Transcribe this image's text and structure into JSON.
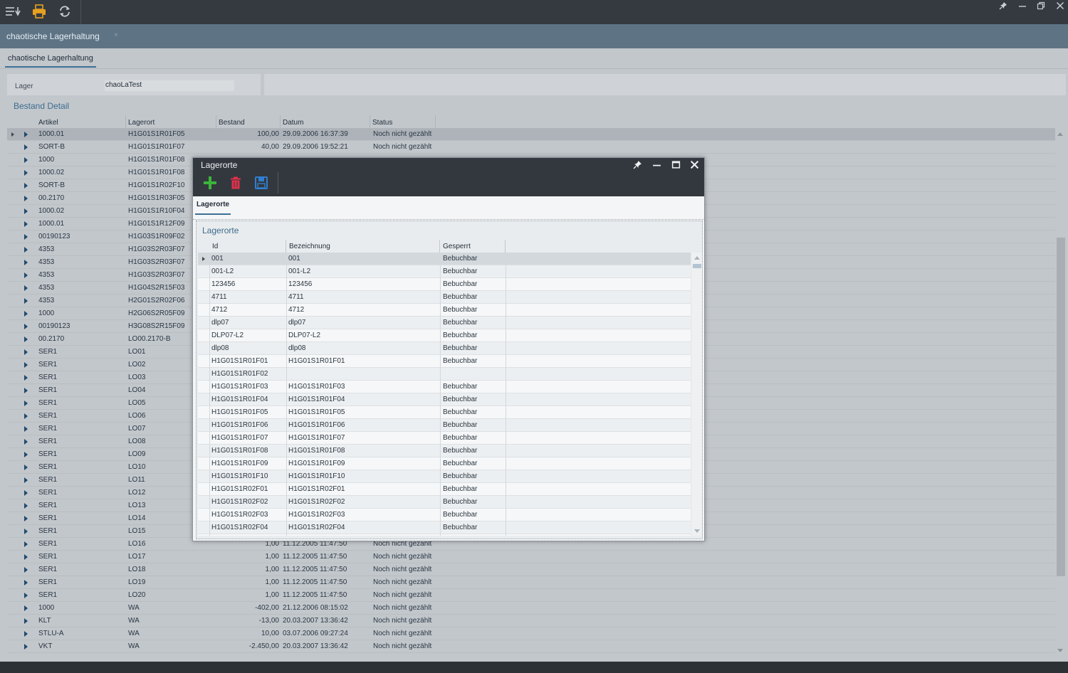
{
  "toolbar": {
    "icons": [
      "grid-export-icon",
      "printer-icon",
      "refresh-icon"
    ],
    "window_controls": [
      "pin-icon",
      "minimize-icon",
      "restore-icon",
      "close-icon"
    ]
  },
  "document_tab": {
    "label": "chaotische Lagerhaltung",
    "close": "×"
  },
  "subtab": {
    "label": "chaotische Lagerhaltung"
  },
  "filter": {
    "label": "Lager",
    "value": "chaoLaTest"
  },
  "section": {
    "title": "Bestand Detail"
  },
  "main_grid": {
    "columns": [
      "Artikel",
      "Lagerort",
      "Bestand",
      "Datum",
      "Status"
    ],
    "rows": [
      [
        "1000.01",
        "H1G01S1R01F05",
        "100,00",
        "29.09.2006 16:37:39",
        "Noch nicht gezählt"
      ],
      [
        "SORT-B",
        "H1G01S1R01F07",
        "40,00",
        "29.09.2006 19:52:21",
        "Noch nicht gezählt"
      ],
      [
        "1000",
        "H1G01S1R01F08",
        "",
        "",
        ""
      ],
      [
        "1000.02",
        "H1G01S1R01F08",
        "",
        "",
        ""
      ],
      [
        "SORT-B",
        "H1G01S1R02F10",
        "",
        "",
        ""
      ],
      [
        "00.2170",
        "H1G01S1R03F05",
        "",
        "",
        ""
      ],
      [
        "1000.02",
        "H1G01S1R10F04",
        "",
        "",
        ""
      ],
      [
        "1000.01",
        "H1G01S1R12F09",
        "",
        "",
        ""
      ],
      [
        "00190123",
        "H1G03S1R09F02",
        "",
        "",
        ""
      ],
      [
        "4353",
        "H1G03S2R03F07",
        "",
        "",
        ""
      ],
      [
        "4353",
        "H1G03S2R03F07",
        "",
        "",
        ""
      ],
      [
        "4353",
        "H1G03S2R03F07",
        "",
        "",
        ""
      ],
      [
        "4353",
        "H1G04S2R15F03",
        "",
        "",
        ""
      ],
      [
        "4353",
        "H2G01S2R02F06",
        "",
        "",
        ""
      ],
      [
        "1000",
        "H2G06S2R05F09",
        "",
        "",
        ""
      ],
      [
        "00190123",
        "H3G08S2R15F09",
        "",
        "",
        ""
      ],
      [
        "00.2170",
        "LO00.2170-B",
        "",
        "",
        ""
      ],
      [
        "SER1",
        "LO01",
        "",
        "",
        ""
      ],
      [
        "SER1",
        "LO02",
        "",
        "",
        ""
      ],
      [
        "SER1",
        "LO03",
        "",
        "",
        ""
      ],
      [
        "SER1",
        "LO04",
        "",
        "",
        ""
      ],
      [
        "SER1",
        "LO05",
        "",
        "",
        ""
      ],
      [
        "SER1",
        "LO06",
        "",
        "",
        ""
      ],
      [
        "SER1",
        "LO07",
        "",
        "",
        ""
      ],
      [
        "SER1",
        "LO08",
        "",
        "",
        ""
      ],
      [
        "SER1",
        "LO09",
        "",
        "",
        ""
      ],
      [
        "SER1",
        "LO10",
        "",
        "",
        ""
      ],
      [
        "SER1",
        "LO11",
        "",
        "",
        ""
      ],
      [
        "SER1",
        "LO12",
        "",
        "",
        ""
      ],
      [
        "SER1",
        "LO13",
        "",
        "",
        ""
      ],
      [
        "SER1",
        "LO14",
        "",
        "",
        ""
      ],
      [
        "SER1",
        "LO15",
        "",
        "",
        ""
      ],
      [
        "SER1",
        "LO16",
        "1,00",
        "11.12.2005 11:47:50",
        "Noch nicht gezählt"
      ],
      [
        "SER1",
        "LO17",
        "1,00",
        "11.12.2005 11:47:50",
        "Noch nicht gezählt"
      ],
      [
        "SER1",
        "LO18",
        "1,00",
        "11.12.2005 11:47:50",
        "Noch nicht gezählt"
      ],
      [
        "SER1",
        "LO19",
        "1,00",
        "11.12.2005 11:47:50",
        "Noch nicht gezählt"
      ],
      [
        "SER1",
        "LO20",
        "1,00",
        "11.12.2005 11:47:50",
        "Noch nicht gezählt"
      ],
      [
        "1000",
        "WA",
        "-402,00",
        "21.12.2006 08:15:02",
        "Noch nicht gezählt"
      ],
      [
        "KLT",
        "WA",
        "-13,00",
        "20.03.2007 13:36:42",
        "Noch nicht gezählt"
      ],
      [
        "STLU-A",
        "WA",
        "10,00",
        "03.07.2006 09:27:24",
        "Noch nicht gezählt"
      ],
      [
        "VKT",
        "WA",
        "-2.450,00",
        "20.03.2007 13:36:42",
        "Noch nicht gezählt"
      ]
    ]
  },
  "modal": {
    "title": "Lagerorte",
    "tools": [
      "add-icon",
      "delete-icon",
      "save-icon"
    ],
    "controls": [
      "pin-icon",
      "minimize-icon",
      "maximize-icon",
      "close-icon"
    ],
    "tab": "Lagerorte",
    "section_title": "Lagerorte",
    "columns": [
      "Id",
      "Bezeichnung",
      "Gesperrt"
    ],
    "rows": [
      [
        "001",
        "001",
        "Bebuchbar"
      ],
      [
        "001-L2",
        "001-L2",
        "Bebuchbar"
      ],
      [
        "123456",
        "123456",
        "Bebuchbar"
      ],
      [
        "4711",
        "4711",
        "Bebuchbar"
      ],
      [
        "4712",
        "4712",
        "Bebuchbar"
      ],
      [
        "dlp07",
        "dlp07",
        "Bebuchbar"
      ],
      [
        "DLP07-L2",
        "DLP07-L2",
        "Bebuchbar"
      ],
      [
        "dlp08",
        "dlp08",
        "Bebuchbar"
      ],
      [
        "H1G01S1R01F01",
        "H1G01S1R01F01",
        "Bebuchbar"
      ],
      [
        "H1G01S1R01F02",
        "",
        ""
      ],
      [
        "H1G01S1R01F03",
        "H1G01S1R01F03",
        "Bebuchbar"
      ],
      [
        "H1G01S1R01F04",
        "H1G01S1R01F04",
        "Bebuchbar"
      ],
      [
        "H1G01S1R01F05",
        "H1G01S1R01F05",
        "Bebuchbar"
      ],
      [
        "H1G01S1R01F06",
        "H1G01S1R01F06",
        "Bebuchbar"
      ],
      [
        "H1G01S1R01F07",
        "H1G01S1R01F07",
        "Bebuchbar"
      ],
      [
        "H1G01S1R01F08",
        "H1G01S1R01F08",
        "Bebuchbar"
      ],
      [
        "H1G01S1R01F09",
        "H1G01S1R01F09",
        "Bebuchbar"
      ],
      [
        "H1G01S1R01F10",
        "H1G01S1R01F10",
        "Bebuchbar"
      ],
      [
        "H1G01S1R02F01",
        "H1G01S1R02F01",
        "Bebuchbar"
      ],
      [
        "H1G01S1R02F02",
        "H1G01S1R02F02",
        "Bebuchbar"
      ],
      [
        "H1G01S1R02F03",
        "H1G01S1R02F03",
        "Bebuchbar"
      ],
      [
        "H1G01S1R02F04",
        "H1G01S1R02F04",
        "Bebuchbar"
      ]
    ]
  },
  "colors": {
    "titlebar": "#353a40",
    "tabstrip": "#5e7485",
    "content_bg": "#c2c7cc",
    "accent": "#3d6b8c",
    "add_green": "#3cb43c",
    "delete_red": "#e0304a",
    "save_blue": "#2f7fd0",
    "print_orange": "#e8a020"
  }
}
